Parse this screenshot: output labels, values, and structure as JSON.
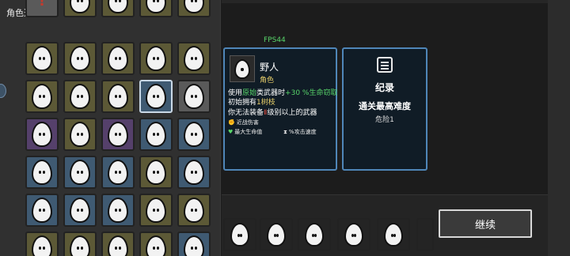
{
  "picker": {
    "title": "角色选择"
  },
  "fps_label": "FPS44",
  "character": {
    "name": "野人",
    "type": "角色",
    "desc_line1": [
      {
        "text": "使用",
        "color": "white"
      },
      {
        "text": "原始",
        "color": "green"
      },
      {
        "text": "类武器时",
        "color": "white"
      },
      {
        "text": "+30 %生命窃取",
        "color": "green"
      }
    ],
    "desc_line2": [
      {
        "text": "初始拥有",
        "color": "white"
      },
      {
        "text": "1树枝",
        "color": "yellow"
      }
    ],
    "desc_line3": [
      {
        "text": "你无法装备",
        "color": "white"
      },
      {
        "text": "Ⅱ",
        "color": "red"
      },
      {
        "text": "级别以上的武器",
        "color": "white"
      }
    ],
    "stat_melee": "近战伤害",
    "stat_maxhp": "最大生命值",
    "stat_attack_speed": "%攻击速度"
  },
  "record": {
    "title": "纪录",
    "subtitle": "通关最高难度",
    "danger": "危险1"
  },
  "continue_label": "继续",
  "colors": {
    "card_border": "#4f86b8",
    "highlight_green": "#58d66a",
    "highlight_yellow": "#e8cf6a",
    "highlight_red": "#d94a3c"
  }
}
